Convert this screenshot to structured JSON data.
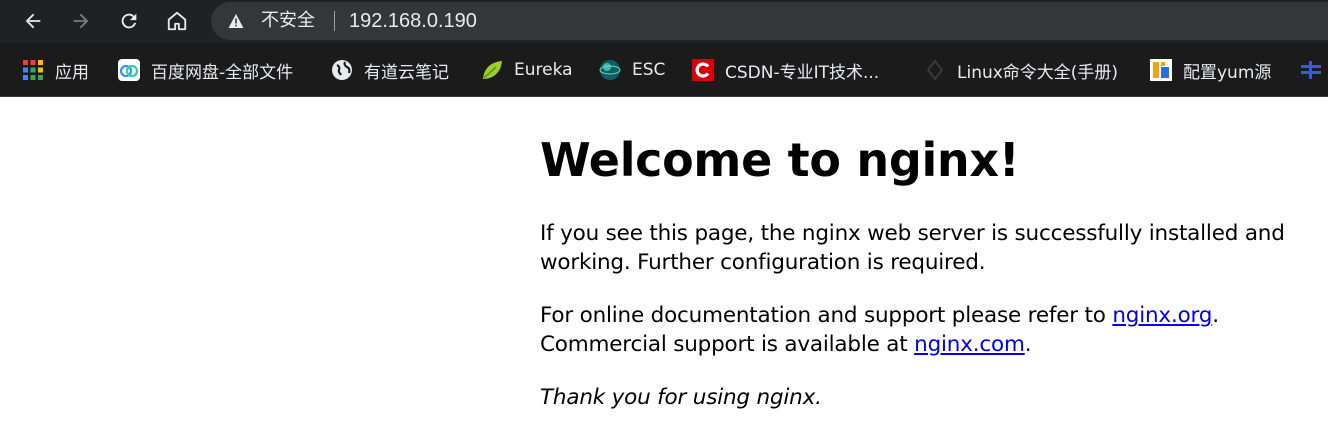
{
  "browser": {
    "security_label": "不安全",
    "url": "192.168.0.190"
  },
  "bookmarks": [
    {
      "label": "应用",
      "icon": "apps-grid-icon"
    },
    {
      "label": "百度网盘-全部文件",
      "icon": "baidu-netdisk-icon"
    },
    {
      "label": "有道云笔记",
      "icon": "globe-icon"
    },
    {
      "label": "Eureka",
      "icon": "eureka-leaf-icon"
    },
    {
      "label": "ESC",
      "icon": "esc-globe-icon"
    },
    {
      "label": "CSDN-专业IT技术...",
      "icon": "csdn-icon"
    },
    {
      "label": "Linux命令大全(手册)",
      "icon": "linux-icon"
    },
    {
      "label": "配置yum源",
      "icon": "yum-icon"
    }
  ],
  "page": {
    "heading": "Welcome to nginx!",
    "para1": "If you see this page, the nginx web server is successfully installed and working. Further configuration is required.",
    "para2_before": "For online documentation and support please refer to ",
    "link1": "nginx.org",
    "para2_mid": ".",
    "para2_line2": "Commercial support is available at ",
    "link2": "nginx.com",
    "para2_end": ".",
    "para3": "Thank you for using nginx."
  },
  "colors": {
    "toolbar_bg": "#202124",
    "link": "#0000ee"
  }
}
